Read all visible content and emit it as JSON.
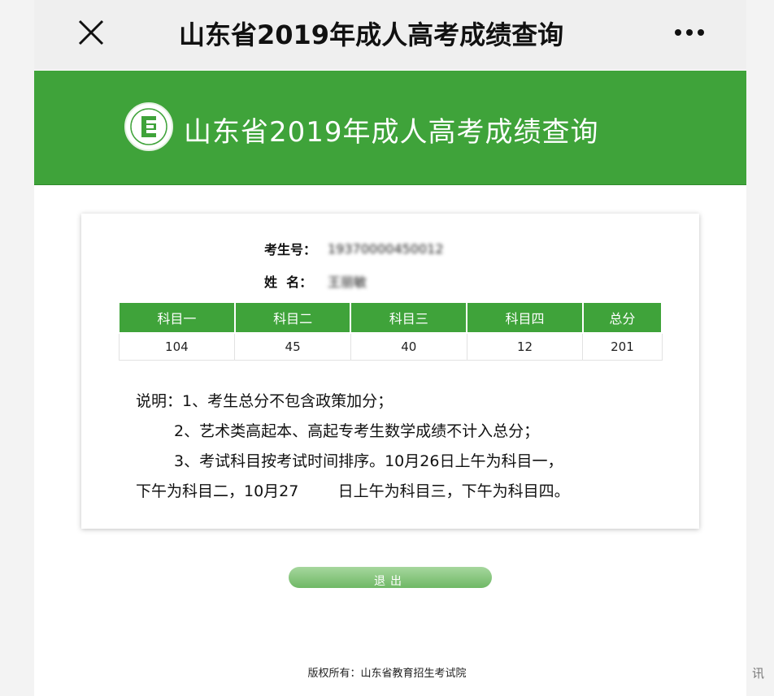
{
  "topbar": {
    "title": "山东省2019年成人高考成绩查询",
    "close_icon": "close-icon",
    "more_icon": "more-horizontal-icon"
  },
  "banner": {
    "title": "山东省2019年成人高考成绩查询",
    "logo_icon": "exam-authority-logo-icon",
    "color": "#3fa33a"
  },
  "candidate": {
    "id_label": "考生号：",
    "id_value": "19370000450012",
    "name_label": "姓  名：",
    "name_value": "王丽敏"
  },
  "scores": {
    "headers": [
      "科目一",
      "科目二",
      "科目三",
      "科目四",
      "总分"
    ],
    "values": [
      "104",
      "45",
      "40",
      "12",
      "201"
    ]
  },
  "notes": [
    "说明：1、考生总分不包含政策加分；",
    "2、艺术类高起本、高起专考生数学成绩不计入总分；",
    "3、考试科目按考试时间排序。10月26日上午为科目一，",
    "下午为科目二，10月27        日上午为科目三，下午为科目四。"
  ],
  "exit_button": "退出",
  "footer": "版权所有：山东省教育招生考试院",
  "watermark": "讯"
}
